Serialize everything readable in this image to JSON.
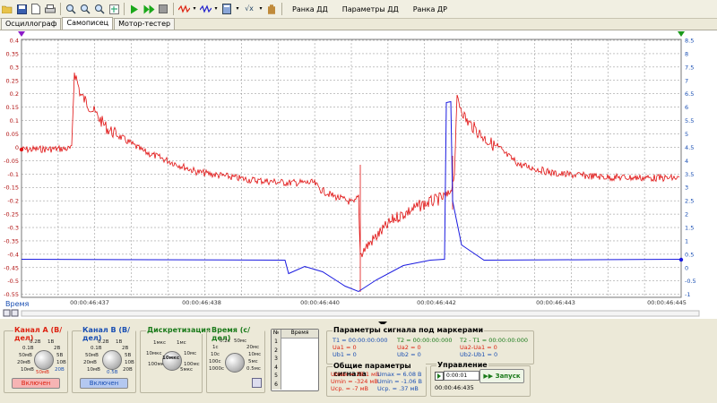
{
  "toolbar": {
    "menu_items": [
      "Ранка ДД",
      "Параметры ДД",
      "Ранка ДР"
    ]
  },
  "tabs": [
    {
      "label": "Осциллограф"
    },
    {
      "label": "Самописец"
    },
    {
      "label": "Мотор-тестер"
    }
  ],
  "plot": {
    "left_axis_ticks": [
      "0.4",
      "0.35",
      "0.3",
      "0.25",
      "0.2",
      "0.15",
      "0.1",
      "0.05",
      "0",
      "-0.05",
      "-0.1",
      "-0.15",
      "-0.2",
      "-0.25",
      "-0.3",
      "-0.35",
      "-0.4",
      "-0.45",
      "-0.5",
      "-0.55"
    ],
    "right_axis_ticks": [
      "8.5",
      "8",
      "7.5",
      "7",
      "6.5",
      "6",
      "5.5",
      "5",
      "4.5",
      "4",
      "3.5",
      "3",
      "2.5",
      "2",
      "1.5",
      "1",
      "0.5",
      "0",
      "-0.5",
      "-1"
    ],
    "time_ticks": [
      "00:00:46:437",
      "00:00:46:438",
      "00:00:46:440",
      "00:00:46:442",
      "00:00:46:443",
      "00:00:46:445"
    ],
    "x_axis_label": "Время",
    "colors": {
      "channel_a": "#e01010",
      "channel_b": "#1a1ae0",
      "grid": "#888888"
    }
  },
  "controls": {
    "channel_a": {
      "title": "Канал А (В/дел)",
      "scale_labels": [
        "0.2В",
        "1В",
        "0.1В",
        "2В",
        "50мВ",
        "5В",
        "20мВ",
        "10В",
        "10мВ",
        "20В"
      ],
      "selected": "50мВ",
      "state_button": "Включен"
    },
    "channel_b": {
      "title": "Канал В (В/дел)",
      "scale_labels": [
        "0.2В",
        "1В",
        "0.1В",
        "2В",
        "50мВ",
        "5В",
        "20мВ",
        "10В",
        "10мВ",
        "20В"
      ],
      "selected": "0.5В",
      "state_button": "Включен"
    },
    "sampling": {
      "title": "Дискретизация",
      "scale_labels": [
        "1мкс",
        "10мкс",
        "100мкс",
        "1мс",
        "10мс",
        "100мс",
        "5мкс"
      ],
      "selected": "10мкс"
    },
    "time": {
      "title": "Время (с/дел)",
      "scale_labels": [
        "0.2с",
        "50мс",
        "1с",
        "20мс",
        "10с",
        "10мс",
        "100с",
        "5мс",
        "1000с",
        "0.5мс"
      ]
    },
    "table": {
      "col_index": "№",
      "col_time": "Время",
      "rows": [
        "1",
        "2",
        "3",
        "4",
        "5",
        "6"
      ]
    },
    "markers": {
      "title": "Параметры сигнала под маркерами",
      "t1": "T1 = 00:00:00:000",
      "t2": "T2 = 00:00:00:000",
      "t2_t1": "T2 - T1 = 00:00:00:000",
      "ua1": "Ua1 = 0",
      "ua2": "Ua2 = 0",
      "ua2_ua1": "Ua2-Ua1 = 0",
      "ub1": "Ub1 = 0",
      "ub2": "Ub2 = 0",
      "ub2_ub1": "Ub2-Ub1 = 0"
    },
    "general": {
      "title": "Общие параметры сигнала",
      "umax_a": "Umax = 28.1 мВ",
      "umin_a": "Umin = -324 мВ",
      "ucp_a": "Uср. = -7 мВ",
      "umax_b": "Umax = 6.08 В",
      "umin_b": "Umin = -1.06 В",
      "ucp_b": "Uср. = .37 мВ"
    },
    "control": {
      "title": "Управление",
      "time_value": "0:00:01",
      "elapsed": "00:00:46:435",
      "start_label": "Запуск"
    }
  }
}
